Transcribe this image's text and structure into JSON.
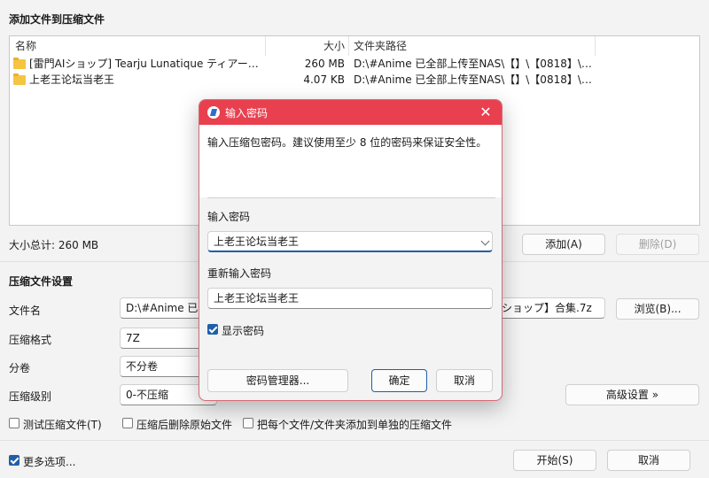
{
  "main": {
    "section_files": "添加文件到压缩文件",
    "columns": {
      "name": "名称",
      "size": "大小",
      "path": "文件夹路径"
    },
    "files": [
      {
        "name": "[雷門AIショップ] Tearju Lunatique ティアーユ・...",
        "size": "260 MB",
        "path": "D:\\#Anime 已全部上传至NAS\\【】\\【0818】\\【..."
      },
      {
        "name": "上老王论坛当老王",
        "size": "4.07 KB",
        "path": "D:\\#Anime 已全部上传至NAS\\【】\\【0818】\\【..."
      }
    ],
    "total_size": "大小总计: 260 MB",
    "add_button": "添加(A)",
    "delete_button": "删除(D)",
    "section_settings": "压缩文件设置",
    "filename_label": "文件名",
    "filename_value": "D:\\#Anime 已全",
    "filename_tail": "ショップ】合集.7z",
    "browse_button": "浏览(B)...",
    "format_label": "压缩格式",
    "format_value": "7Z",
    "volume_label": "分卷",
    "volume_value": "不分卷",
    "level_label": "压缩级别",
    "level_value": "0-不压缩",
    "advanced_button": "高级设置 »",
    "test_checkbox": "测试压缩文件(T)",
    "delete_after_checkbox": "压缩后删除原始文件",
    "separate_checkbox": "把每个文件/文件夹添加到单独的压缩文件",
    "more_options_checkbox": "更多选项...",
    "start_button": "开始(S)",
    "cancel_button": "取消"
  },
  "dialog": {
    "title": "输入密码",
    "hint": "输入压缩包密码。建议使用至少 8 位的密码来保证安全性。",
    "password_label": "输入密码",
    "password_value": "上老王论坛当老王",
    "reenter_label": "重新输入密码",
    "reenter_value": "上老王论坛当老王",
    "show_password": "显示密码",
    "manager_button": "密码管理器...",
    "ok_button": "确定",
    "cancel_button": "取消",
    "close_glyph": "✕"
  },
  "colors": {
    "title_bar": "#e8404f",
    "accent": "#1f5fa8",
    "folder": "#f5c542"
  },
  "icons": [
    "folder-icon",
    "app-icon",
    "close-icon",
    "chevron-down-icon",
    "checkbox-icon"
  ]
}
